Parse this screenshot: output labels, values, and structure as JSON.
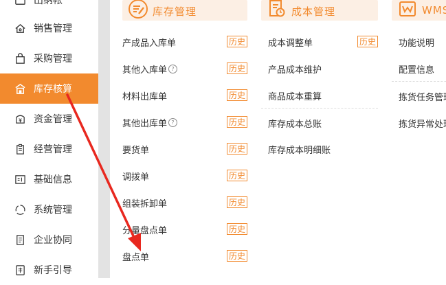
{
  "sidebar": {
    "items": [
      {
        "label": "出纳帐",
        "icon": "cash-icon"
      },
      {
        "label": "销售管理",
        "icon": "house-icon"
      },
      {
        "label": "采购管理",
        "icon": "bag-icon"
      },
      {
        "label": "库存核算",
        "icon": "store-icon",
        "active": true
      },
      {
        "label": "资金管理",
        "icon": "yen-icon"
      },
      {
        "label": "经营管理",
        "icon": "clipboard-icon"
      },
      {
        "label": "基础信息",
        "icon": "id-card-icon"
      },
      {
        "label": "系统管理",
        "icon": "cycle-icon"
      },
      {
        "label": "企业协同",
        "icon": "document-icon"
      },
      {
        "label": "新手引导",
        "icon": "new-icon"
      }
    ]
  },
  "inventory": {
    "title": "库存管理",
    "history_label": "历史",
    "items": [
      {
        "label": "产成品入库单",
        "help": false,
        "history": true
      },
      {
        "label": "其他入库单",
        "help": true,
        "history": true
      },
      {
        "label": "材料出库单",
        "help": false,
        "history": true
      },
      {
        "label": "其他出库单",
        "help": true,
        "history": true
      },
      {
        "label": "要货单",
        "help": false,
        "history": true
      },
      {
        "label": "调拨单",
        "help": false,
        "history": true
      },
      {
        "label": "组装拆卸单",
        "help": false,
        "history": true
      },
      {
        "label": "分量盘点单",
        "help": false,
        "history": true
      },
      {
        "label": "盘点单",
        "help": false,
        "history": true
      }
    ],
    "help_glyph": "?"
  },
  "cost": {
    "title": "成本管理",
    "history_label": "历史",
    "items": [
      {
        "label": "成本调整单",
        "history": true
      },
      {
        "label": "产品成本维护",
        "history": false
      },
      {
        "label": "商品成本重算",
        "history": false
      },
      {
        "label": "库存成本总账",
        "history": false
      },
      {
        "label": "库存成本明细账",
        "history": false
      }
    ]
  },
  "wms": {
    "title": "WMS",
    "items": [
      {
        "label": "功能说明"
      },
      {
        "label": "配置信息"
      },
      {
        "label": "拣货任务管理"
      },
      {
        "label": "拣货异常处理"
      }
    ]
  },
  "colors": {
    "accent": "#f28a2e",
    "header_bg": "#fcefe4",
    "arrow": "#e8281f"
  }
}
